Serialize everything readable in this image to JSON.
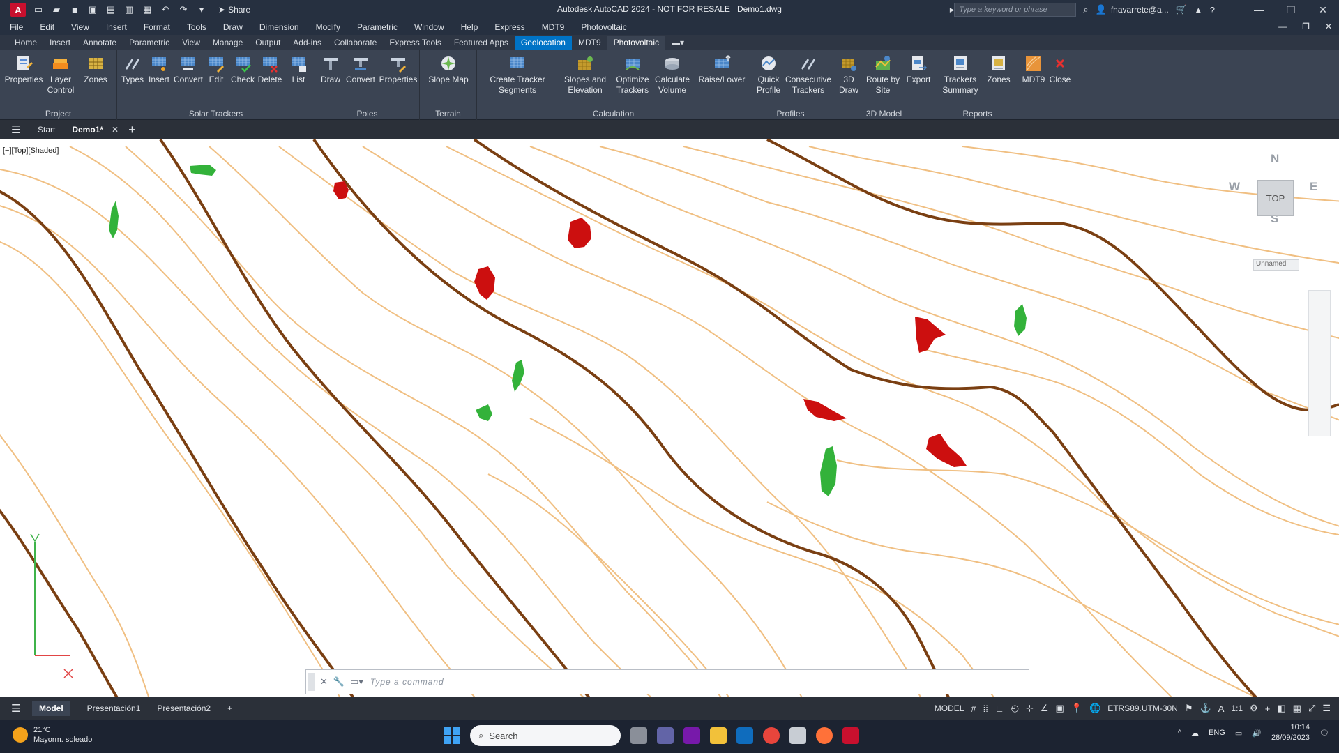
{
  "titlebar": {
    "app_letter": "A",
    "share": "Share",
    "title": "Autodesk AutoCAD 2024 - NOT FOR RESALE",
    "filename": "Demo1.dwg",
    "search_placeholder": "Type a keyword or phrase",
    "user": "fnavarrete@a..."
  },
  "menu": [
    "File",
    "Edit",
    "View",
    "Insert",
    "Format",
    "Tools",
    "Draw",
    "Dimension",
    "Modify",
    "Parametric",
    "Window",
    "Help",
    "Express",
    "MDT9",
    "Photovoltaic"
  ],
  "ribbon_tabs": [
    "Home",
    "Insert",
    "Annotate",
    "Parametric",
    "View",
    "Manage",
    "Output",
    "Add-ins",
    "Collaborate",
    "Express Tools",
    "Featured Apps",
    "Geolocation",
    "MDT9",
    "Photovoltaic"
  ],
  "ribbon_active_tab": "Geolocation",
  "panels": {
    "project": {
      "title": "Project",
      "buttons": [
        "Properties",
        "Layer Control",
        "Zones"
      ]
    },
    "solar": {
      "title": "Solar Trackers",
      "buttons": [
        "Types",
        "Insert",
        "Convert",
        "Edit",
        "Check",
        "Delete",
        "List"
      ]
    },
    "poles": {
      "title": "Poles",
      "buttons": [
        "Draw",
        "Convert",
        "Properties"
      ]
    },
    "terrain": {
      "title": "Terrain",
      "buttons": [
        "Slope Map"
      ]
    },
    "calculation": {
      "title": "Calculation",
      "buttons": [
        "Create Tracker Segments",
        "Slopes and Elevation",
        "Optimize Trackers",
        "Calculate Volume",
        "Raise/Lower"
      ]
    },
    "profiles": {
      "title": "Profiles",
      "buttons": [
        "Quick Profile",
        "Consecutive Trackers"
      ]
    },
    "model3d": {
      "title": "3D Model",
      "buttons": [
        "3D Draw",
        "Route by Site",
        "Export"
      ]
    },
    "reports": {
      "title": "Reports",
      "buttons": [
        "Trackers Summary",
        "Zones"
      ]
    },
    "extra": {
      "buttons": [
        "MDT9",
        "Close"
      ]
    }
  },
  "filetabs": {
    "start": "Start",
    "doc": "Demo1*"
  },
  "viewport": {
    "label": "[−][Top][Shaded]",
    "viewcube": {
      "n": "N",
      "s": "S",
      "e": "E",
      "w": "W",
      "face": "TOP",
      "ucs": "Unnamed"
    },
    "command_placeholder": "Type a command"
  },
  "statusbar": {
    "tabs": [
      "Model",
      "Presentación1",
      "Presentación2"
    ],
    "mode": "MODEL",
    "coord_system": "ETRS89.UTM-30N",
    "scale": "1:1"
  },
  "taskbar": {
    "temp": "21°C",
    "weather": "Mayorm. soleado",
    "search": "Search",
    "lang": "ENG",
    "time": "10:14",
    "date": "28/09/2023"
  },
  "colors": {
    "major_contour": "#7a3f12",
    "minor_contour": "#f0bf82",
    "red_patch": "#cc0f0f",
    "green_patch": "#33b23a",
    "accent": "#0073c6"
  }
}
